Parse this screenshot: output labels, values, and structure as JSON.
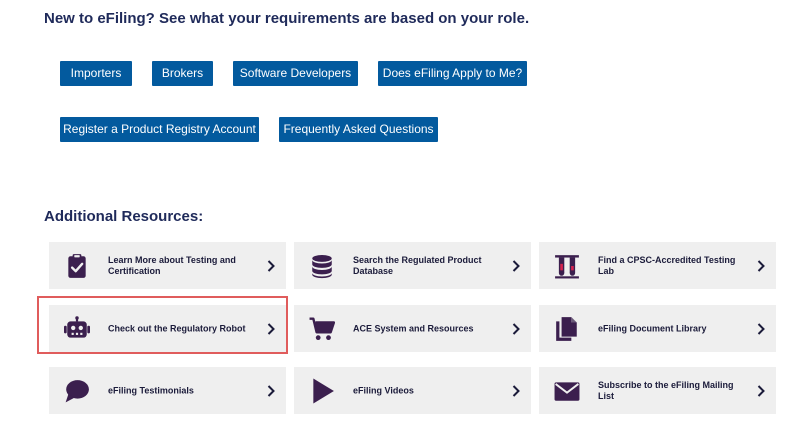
{
  "headings": {
    "intro": "New to eFiling? See what your requirements are based on your role.",
    "resources": "Additional Resources:"
  },
  "buttons": {
    "importers": "Importers",
    "brokers": "Brokers",
    "software_developers": "Software Developers",
    "does_efiling_apply": "Does eFiling Apply to Me?",
    "register_product_registry": "Register a Product Registry Account",
    "faq": "Frequently Asked Questions"
  },
  "resources": {
    "testing": {
      "label": "Learn More about Testing and Certification",
      "icon": "clipboard-check-icon"
    },
    "search_db": {
      "label": "Search the Regulated Product Database",
      "icon": "database-icon"
    },
    "testing_lab": {
      "label": "Find a CPSC-Accredited Testing Lab",
      "icon": "test-tubes-icon"
    },
    "robot": {
      "label": "Check out the Regulatory Robot",
      "icon": "robot-icon"
    },
    "ace": {
      "label": "ACE System and Resources",
      "icon": "shopping-cart-icon"
    },
    "doc_library": {
      "label": "eFiling Document Library",
      "icon": "documents-icon"
    },
    "testimonials": {
      "label": "eFiling Testimonials",
      "icon": "speech-bubble-icon"
    },
    "videos": {
      "label": "eFiling Videos",
      "icon": "play-icon"
    },
    "mailing_list": {
      "label": "Subscribe to the eFiling Mailing List",
      "icon": "envelope-icon"
    }
  },
  "colors": {
    "button_bg": "#035a9e",
    "card_bg": "#efefef",
    "icon": "#3b1f4e",
    "heading": "#1f2a5a",
    "highlight": "#e05c5c"
  }
}
